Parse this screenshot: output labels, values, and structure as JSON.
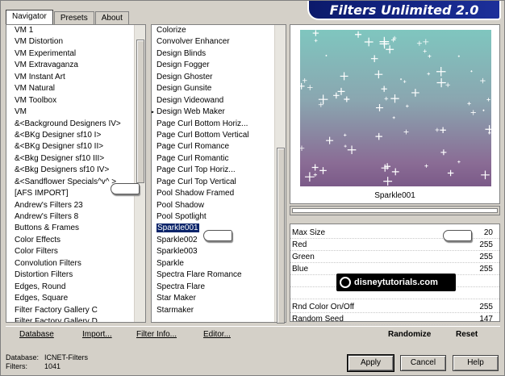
{
  "window": {
    "title": "Filters Unlimited 2.0"
  },
  "tabs": [
    {
      "label": "Navigator"
    },
    {
      "label": "Presets"
    },
    {
      "label": "About"
    }
  ],
  "categories": [
    "VM 1",
    "VM Distortion",
    "VM Experimental",
    "VM Extravaganza",
    "VM Instant Art",
    "VM Natural",
    "VM Toolbox",
    "VM",
    "&<Background Designers IV>",
    "&<BKg Designer sf10 I>",
    "&<BKg Designer sf10 II>",
    "&<Bkg Designer sf10 III>",
    "&<Bkg Designers sf10 IV>",
    "&<Sandflower Specials^v^ >",
    "[AFS IMPORT]",
    "Andrew's Filters 23",
    "Andrew's Filters 8",
    "Buttons & Frames",
    "Color Effects",
    "Color Filters",
    "Convolution Filters",
    "Distortion Filters",
    "Edges, Round",
    "Edges, Square",
    "Filter Factory Gallery C",
    "Filter Factory Gallery D"
  ],
  "filters": [
    "Colorize",
    "Convolver Enhancer",
    "Design Blinds",
    "Design Fogger",
    "Design Ghoster",
    "Design Gunsite",
    "Design Videowand",
    "Design Web Maker",
    "Page Curl Bottom Horiz...",
    "Page Curl Bottom Vertical",
    "Page Curl Romance",
    "Page Curl Romantic",
    "Page Curl Top Horiz...",
    "Page Curl Top Vertical",
    "Pool Shadow Framed",
    "Pool Shadow",
    "Pool Spotlight",
    "Sparkle001",
    "Sparkle002",
    "Sparkle003",
    "Sparkle",
    "Spectra Flare Romance",
    "Spectra Flare",
    "Star Maker",
    "Starmaker"
  ],
  "selected_filter": "Sparkle001",
  "preview": {
    "label": "Sparkle001"
  },
  "params": [
    {
      "label": "Max Size",
      "value": "20"
    },
    {
      "label": "Red",
      "value": "255"
    },
    {
      "label": "Green",
      "value": "255"
    },
    {
      "label": "Blue",
      "value": "255"
    },
    {
      "label": "",
      "value": ""
    },
    {
      "label": "",
      "value": ""
    },
    {
      "label": "Rnd Color On/Off",
      "value": "255"
    },
    {
      "label": "Random Seed",
      "value": "147"
    }
  ],
  "watermark": "disneytutorials.com",
  "links": {
    "database": "Database",
    "import": "Import...",
    "filter_info": "Filter Info...",
    "editor": "Editor...",
    "randomize": "Randomize",
    "reset": "Reset"
  },
  "status": {
    "database_label": "Database:",
    "database_value": "ICNET-Filters",
    "filters_label": "Filters:",
    "filters_value": "1041"
  },
  "buttons": {
    "apply": "Apply",
    "cancel": "Cancel",
    "help": "Help"
  },
  "colors": {
    "selection": "#0a246a",
    "banner": "#0b1a6b"
  }
}
